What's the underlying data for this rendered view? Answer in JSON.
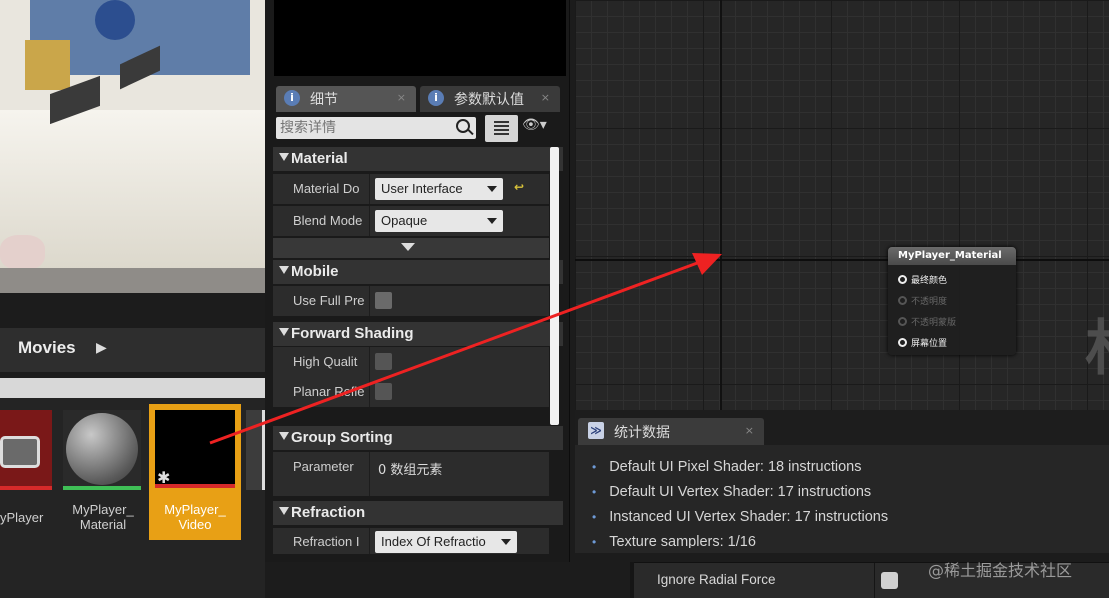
{
  "content_browser": {
    "folder": "Movies",
    "assets": [
      {
        "label": "yPlayer"
      },
      {
        "label": "MyPlayer_\nMaterial"
      },
      {
        "label": "MyPlayer_\nVideo"
      }
    ]
  },
  "details": {
    "tabs": [
      {
        "label": "细节",
        "close": "×"
      },
      {
        "label": "参数默认值",
        "close": "×"
      }
    ],
    "search_placeholder": "搜索详情",
    "sections": {
      "material": {
        "title": "Material",
        "rows": [
          {
            "label": "Material Do",
            "value": "User Interface"
          },
          {
            "label": "Blend Mode",
            "value": "Opaque"
          }
        ]
      },
      "mobile": {
        "title": "Mobile",
        "rows": [
          {
            "label": "Use Full Pre"
          }
        ]
      },
      "forward": {
        "title": "Forward Shading",
        "rows": [
          {
            "label": "High Qualit"
          },
          {
            "label": "Planar Refle"
          }
        ]
      },
      "group": {
        "title": "Group Sorting",
        "rows": [
          {
            "label": "Parameter",
            "value": "0 数组元素"
          }
        ]
      },
      "refraction": {
        "title": "Refraction",
        "rows": [
          {
            "label": "Refraction I",
            "value": "Index Of Refractio"
          }
        ]
      }
    }
  },
  "graph": {
    "node": {
      "title": "MyPlayer_Material",
      "pins": [
        {
          "label": "最终颜色",
          "enabled": true
        },
        {
          "label": "不透明度",
          "enabled": false
        },
        {
          "label": "不透明蒙版",
          "enabled": false
        },
        {
          "label": "屏幕位置",
          "enabled": true
        }
      ]
    },
    "bg_char": "材"
  },
  "stats": {
    "tab_label": "统计数据",
    "close": "×",
    "lines": [
      "Default UI Pixel Shader: 18 instructions",
      "Default UI Vertex Shader: 17 instructions",
      "Instanced UI Vertex Shader: 17 instructions",
      "Texture samplers: 1/16"
    ]
  },
  "bottom": {
    "label": "Ignore Radial Force"
  },
  "watermark": "@稀土掘金技术社区",
  "colors": {
    "accent_arrow": "#ee2222",
    "selected_asset": "#e8a015",
    "material_bar": "#3fbf56",
    "video_bar": "#d62a2a"
  }
}
